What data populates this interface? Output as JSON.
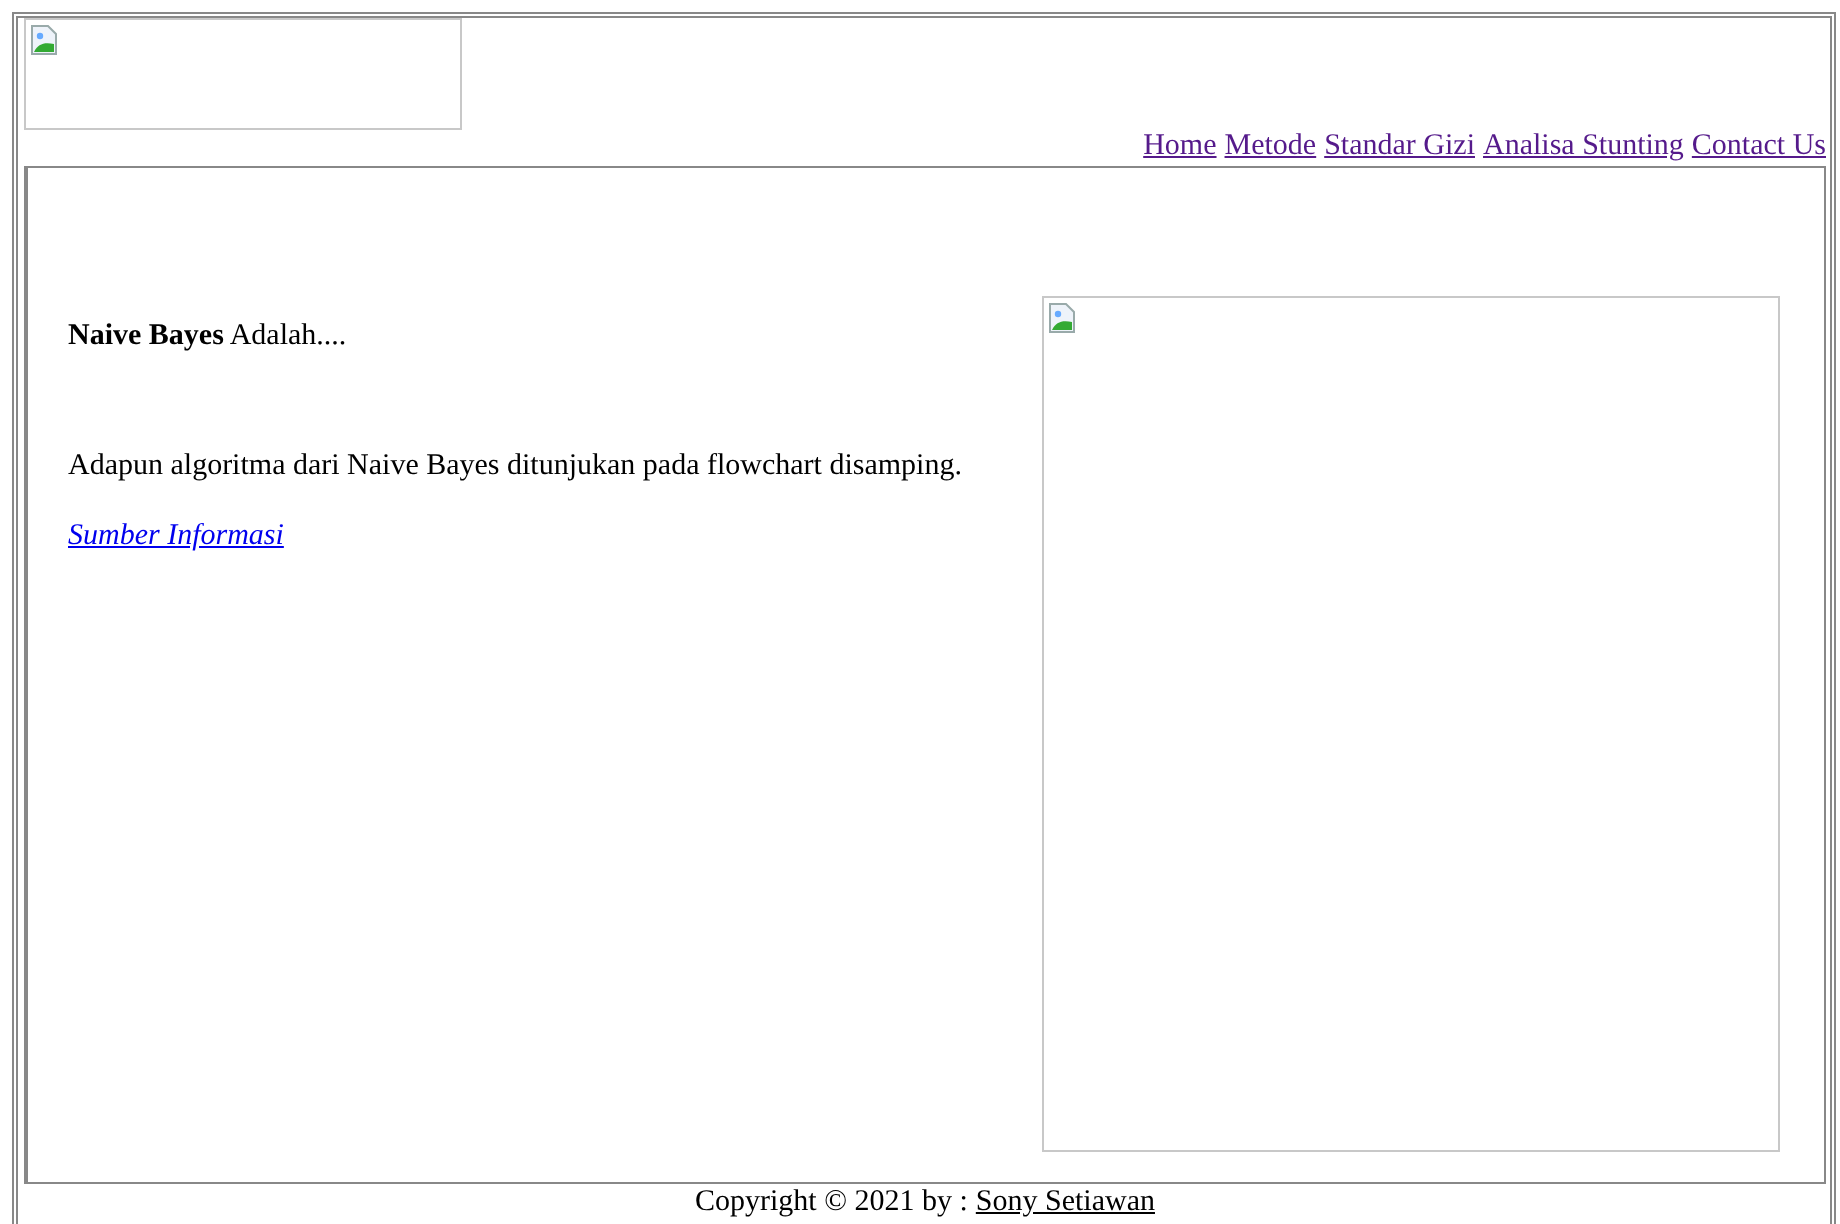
{
  "nav": {
    "links": [
      "Home",
      "Metode",
      "Standar Gizi",
      "Analisa Stunting",
      "Contact Us"
    ]
  },
  "content": {
    "intro": "**Naive Bayes** Adalah....",
    "paragraph": "Adapun algoritma dari Naive Bayes ditunjukan pada flowchart disamping.",
    "source_link": "Sumber Informasi"
  },
  "footer": {
    "text": "Copyright © 2021 by :",
    "author_link": "Sony Setiawan"
  }
}
